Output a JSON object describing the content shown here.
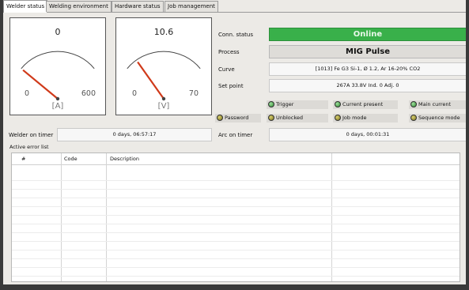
{
  "tabs": [
    "Welder status",
    "Welding environment",
    "Hardware status",
    "Job management"
  ],
  "gauges": [
    {
      "value": "0",
      "min": "0",
      "max": "600",
      "unit": "[A]",
      "fraction": 0
    },
    {
      "value": "10.6",
      "min": "0",
      "max": "70",
      "unit": "[V]",
      "fraction": 0.15
    }
  ],
  "status": {
    "conn_label": "Conn. status",
    "conn_value": "Online",
    "process_label": "Process",
    "process_value": "MIG Pulse",
    "curve_label": "Curve",
    "curve_value": "[1013] Fe G3 Si-1, Ø 1.2, Ar 16-20% CO2",
    "setpoint_label": "Set point",
    "setpoint_value": "267A 33.8V Ind. 0 Adj. 0"
  },
  "indicators": {
    "trigger": "Trigger",
    "current_present": "Current present",
    "main_current": "Main current",
    "password": "Password",
    "unblocked": "Unblocked",
    "job_mode": "Job mode",
    "sequence_mode": "Sequence mode"
  },
  "timers": {
    "welder_label": "Welder on timer",
    "welder_value": "0 days, 06:57:17",
    "arc_label": "Arc on timer",
    "arc_value": "0 days, 00:01:31"
  },
  "errors": {
    "title": "Active error list",
    "columns": [
      "#",
      "Code",
      "Description"
    ]
  },
  "colors": {
    "online": "#39b04a",
    "needle": "#d03a1a"
  }
}
